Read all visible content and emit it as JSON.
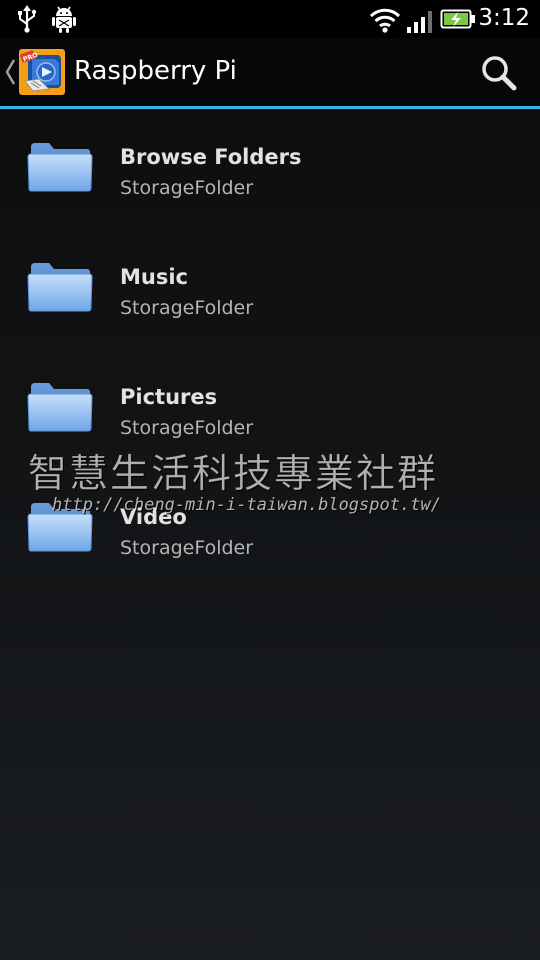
{
  "status_bar": {
    "time": "3:12",
    "icons": [
      "usb-icon",
      "android-debug-icon",
      "wifi-icon",
      "signal-icon",
      "battery-charging-icon"
    ]
  },
  "action_bar": {
    "title": "Raspberry Pi",
    "app_icon": "app-logo-icon",
    "app_icon_badge": "PRO",
    "back_icon": "back-caret-icon",
    "search_icon": "search-icon",
    "accent_color": "#33b5e5"
  },
  "folders": [
    {
      "title": "Browse Folders",
      "subtitle": "StorageFolder",
      "icon": "folder-icon"
    },
    {
      "title": "Music",
      "subtitle": "StorageFolder",
      "icon": "folder-icon"
    },
    {
      "title": "Pictures",
      "subtitle": "StorageFolder",
      "icon": "folder-icon"
    },
    {
      "title": "Video",
      "subtitle": "StorageFolder",
      "icon": "folder-icon"
    }
  ],
  "watermark": {
    "line1": "智慧生活科技專業社群",
    "line2": "http://cheng-min-i-taiwan.blogspot.tw/"
  }
}
